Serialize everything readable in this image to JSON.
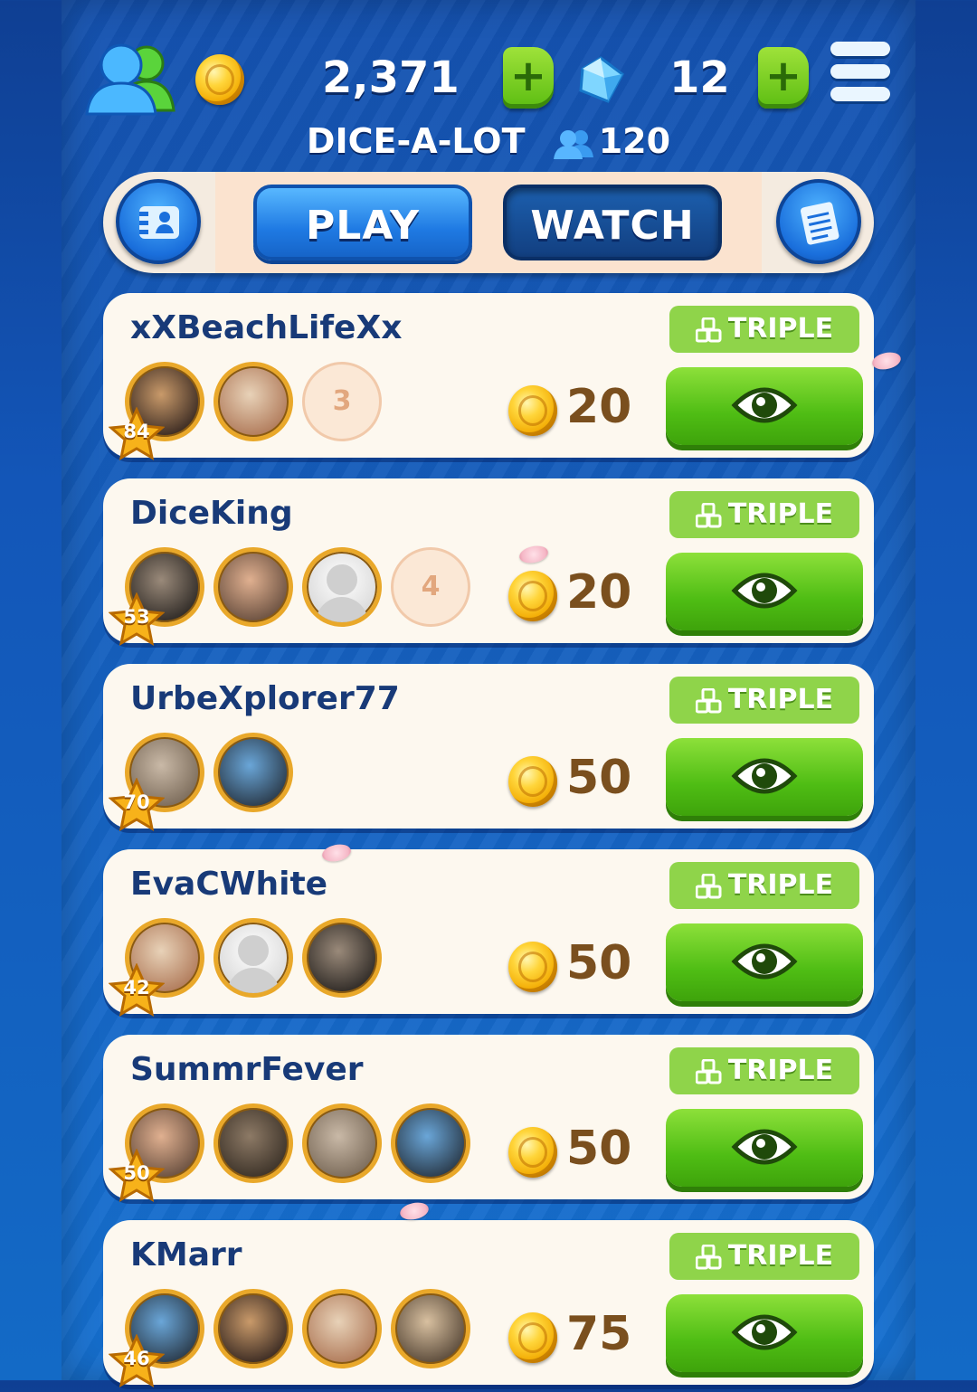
{
  "colors": {
    "accent_blue": "#1f7ae3",
    "watch_green": "#4fbd14",
    "name_navy": "#183a78",
    "badge_green": "#8fd44a",
    "avatar_gold": "#e9a82a"
  },
  "header": {
    "coins": "2,371",
    "gems": "12",
    "club_name": "DICE-A-LOT",
    "club_members": "120",
    "icons": [
      "friends-icon",
      "coin-icon",
      "add-coins-icon",
      "gem-icon",
      "add-gems-icon",
      "menu-icon"
    ]
  },
  "tabs": {
    "play_label": "PLAY",
    "watch_label": "WATCH",
    "active": "WATCH",
    "left_icon": "contacts-icon",
    "right_icon": "notepad-icon"
  },
  "games": [
    {
      "name": "xXBeachLifeXx",
      "mode": "TRIPLE",
      "level": "84",
      "avatars": [
        "photo",
        "photo"
      ],
      "more": "3",
      "fee": "20"
    },
    {
      "name": "DiceKing",
      "mode": "TRIPLE",
      "level": "53",
      "avatars": [
        "photo",
        "photo",
        "empty"
      ],
      "more": "4",
      "fee": "20"
    },
    {
      "name": "UrbeXplorer77",
      "mode": "TRIPLE",
      "level": "70",
      "avatars": [
        "photo",
        "photo"
      ],
      "more": "",
      "fee": "50"
    },
    {
      "name": "EvaCWhite",
      "mode": "TRIPLE",
      "level": "42",
      "avatars": [
        "photo",
        "empty",
        "photo"
      ],
      "more": "",
      "fee": "50"
    },
    {
      "name": "SummrFever",
      "mode": "TRIPLE",
      "level": "50",
      "avatars": [
        "photo",
        "photo",
        "photo",
        "photo"
      ],
      "more": "",
      "fee": "50"
    },
    {
      "name": "KMarr",
      "mode": "TRIPLE",
      "level": "46",
      "avatars": [
        "photo",
        "photo",
        "photo",
        "photo"
      ],
      "more": "",
      "fee": "75"
    }
  ]
}
